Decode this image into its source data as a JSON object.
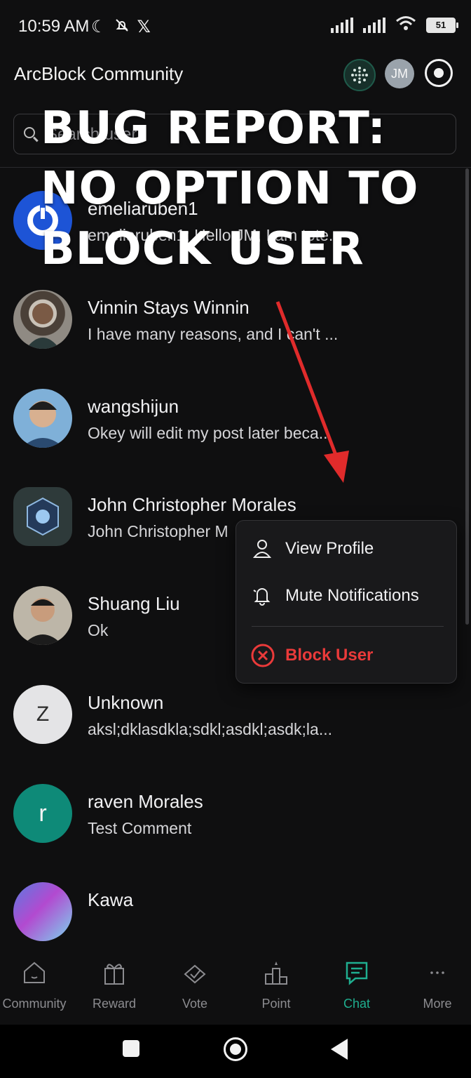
{
  "status": {
    "time": "10:59 AM",
    "battery": "51"
  },
  "header": {
    "title": "ArcBlock Community",
    "avatar_initials": "JM"
  },
  "search": {
    "placeholder": "Search user"
  },
  "banner": {
    "line1": "BUG REPORT:",
    "line2": "NO OPTION TO",
    "line3": "BLOCK USER"
  },
  "chats": [
    {
      "name": "emeliaruben1",
      "preview": "emeliaruben1: Hello JM, I am tote...",
      "avatar": "blue-logo"
    },
    {
      "name": "Vinnin Stays Winnin",
      "preview": "I have many reasons, and I can't ...",
      "avatar": "photo"
    },
    {
      "name": "wangshijun",
      "preview": "Okey will edit my post later beca...",
      "avatar": "photo"
    },
    {
      "name": "John Christopher Morales",
      "preview": "John Christopher M",
      "avatar": "badge"
    },
    {
      "name": "Shuang Liu",
      "preview": "Ok",
      "avatar": "photo"
    },
    {
      "name": "Unknown",
      "preview": "aksl;dklasdkla;sdkl;asdkl;asdk;la...",
      "avatar_letter": "Z"
    },
    {
      "name": "raven Morales",
      "preview": "Test Comment",
      "avatar_letter": "r"
    },
    {
      "name": "Kawa",
      "preview": "",
      "avatar": "gradient"
    }
  ],
  "context_menu": {
    "view_profile": "View Profile",
    "mute": "Mute Notifications",
    "block": "Block User"
  },
  "tabs": [
    {
      "label": "Community"
    },
    {
      "label": "Reward"
    },
    {
      "label": "Vote"
    },
    {
      "label": "Point"
    },
    {
      "label": "Chat",
      "active": true
    },
    {
      "label": "More"
    }
  ],
  "colors": {
    "accent": "#1fae8f",
    "danger": "#ea3a3a",
    "arrow": "#e02b2b"
  }
}
